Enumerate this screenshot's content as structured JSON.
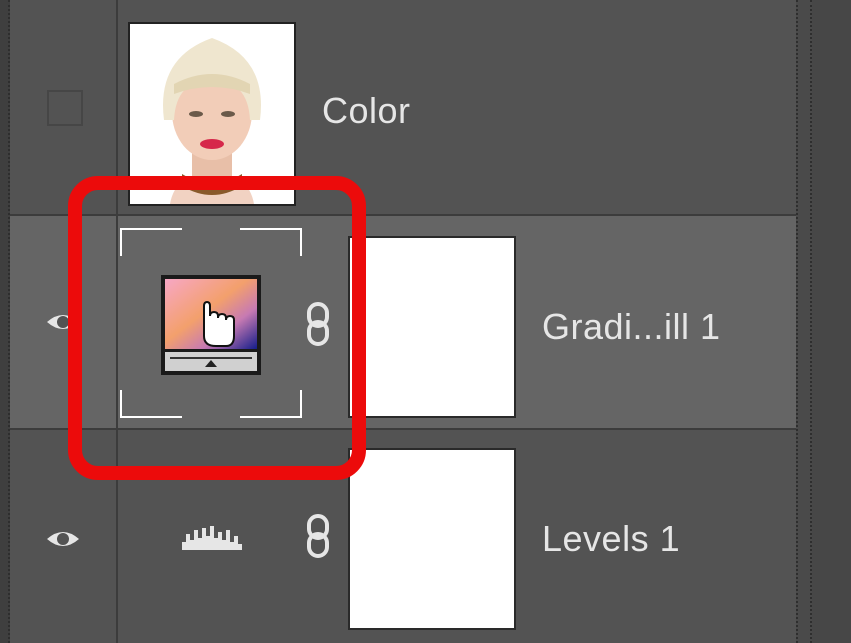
{
  "layers": [
    {
      "name": "Color",
      "type": "pixel",
      "visible": false,
      "selected": false,
      "thumbnail": "portrait-photo"
    },
    {
      "name": "Gradi...ill 1",
      "type": "gradient-fill",
      "visible": true,
      "selected": true,
      "thumbnail": "gradient-fill-icon",
      "linked_mask": true
    },
    {
      "name": "Levels 1",
      "type": "levels-adjustment",
      "visible": true,
      "selected": false,
      "thumbnail": "levels-histogram-icon",
      "linked_mask": true
    }
  ],
  "colors": {
    "panel_bg": "#535353",
    "selected_row_bg": "#656565",
    "text": "#e6e6e6",
    "highlight": "#ec0b0b"
  },
  "annotation": {
    "shape": "rounded-rectangle",
    "target": "gradient-fill-thumbnail"
  }
}
